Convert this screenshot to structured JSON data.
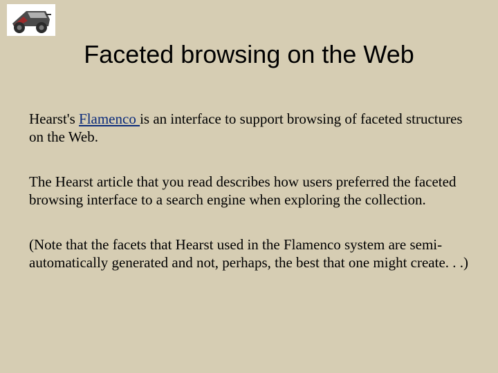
{
  "title": "Faceted browsing on the Web",
  "p1_a": "Hearst's ",
  "link": "Flamenco ",
  "p1_b": "is an interface to support browsing of faceted structures on the Web.",
  "p2": "The Hearst article that you read describes how users preferred the faceted browsing interface to a search engine when exploring the collection.",
  "p3": "(Note that the facets that Hearst used in the Flamenco system are semi-automatically generated and not, perhaps, the best that one might create. . .)"
}
